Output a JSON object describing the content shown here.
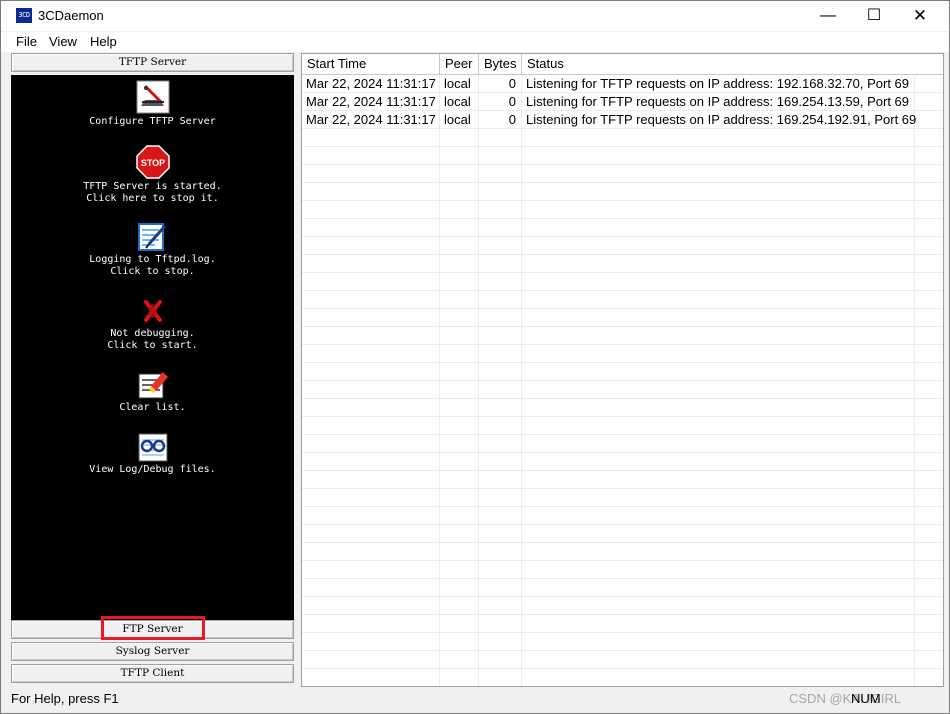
{
  "window": {
    "title": "3CDaemon",
    "icon_text": "3CD",
    "minimize_glyph": "—",
    "maximize_glyph": "☐",
    "close_glyph": "✕"
  },
  "menu": [
    "File",
    "View",
    "Help"
  ],
  "left_pane": {
    "top_button": "TFTP Server",
    "actions": [
      {
        "icon": "configure-icon",
        "label": "Configure TFTP Server"
      },
      {
        "icon": "stop-sign-icon",
        "icon_text": "STOP",
        "label": "TFTP Server is started.\nClick here to stop it."
      },
      {
        "icon": "logging-icon",
        "label": "Logging to Tftpd.log.\nClick to stop."
      },
      {
        "icon": "debug-off-icon",
        "label": "Not debugging.\nClick to start."
      },
      {
        "icon": "clear-list-icon",
        "label": "Clear list."
      },
      {
        "icon": "view-files-icon",
        "label": "View Log/Debug files."
      }
    ],
    "bottom_buttons": [
      "FTP Server",
      "Syslog Server",
      "TFTP Client"
    ]
  },
  "list": {
    "columns": [
      "Start Time",
      "Peer",
      "Bytes",
      "Status"
    ],
    "rows": [
      [
        "Mar 22, 2024 11:31:17",
        "local",
        "0",
        "Listening for TFTP requests on IP address: 192.168.32.70, Port 69"
      ],
      [
        "Mar 22, 2024 11:31:17",
        "local",
        "0",
        "Listening for TFTP requests on IP address: 169.254.13.59, Port 69"
      ],
      [
        "Mar 22, 2024 11:31:17",
        "local",
        "0",
        "Listening for TFTP requests on IP address: 169.254.192.91, Port 69"
      ]
    ]
  },
  "statusbar": {
    "help": "For Help, press F1",
    "num": "NUM",
    "watermark": "CSDN @KAI !GIRL"
  },
  "colors": {
    "highlight_box": "#e8182c",
    "panel_bg": "#000000"
  }
}
